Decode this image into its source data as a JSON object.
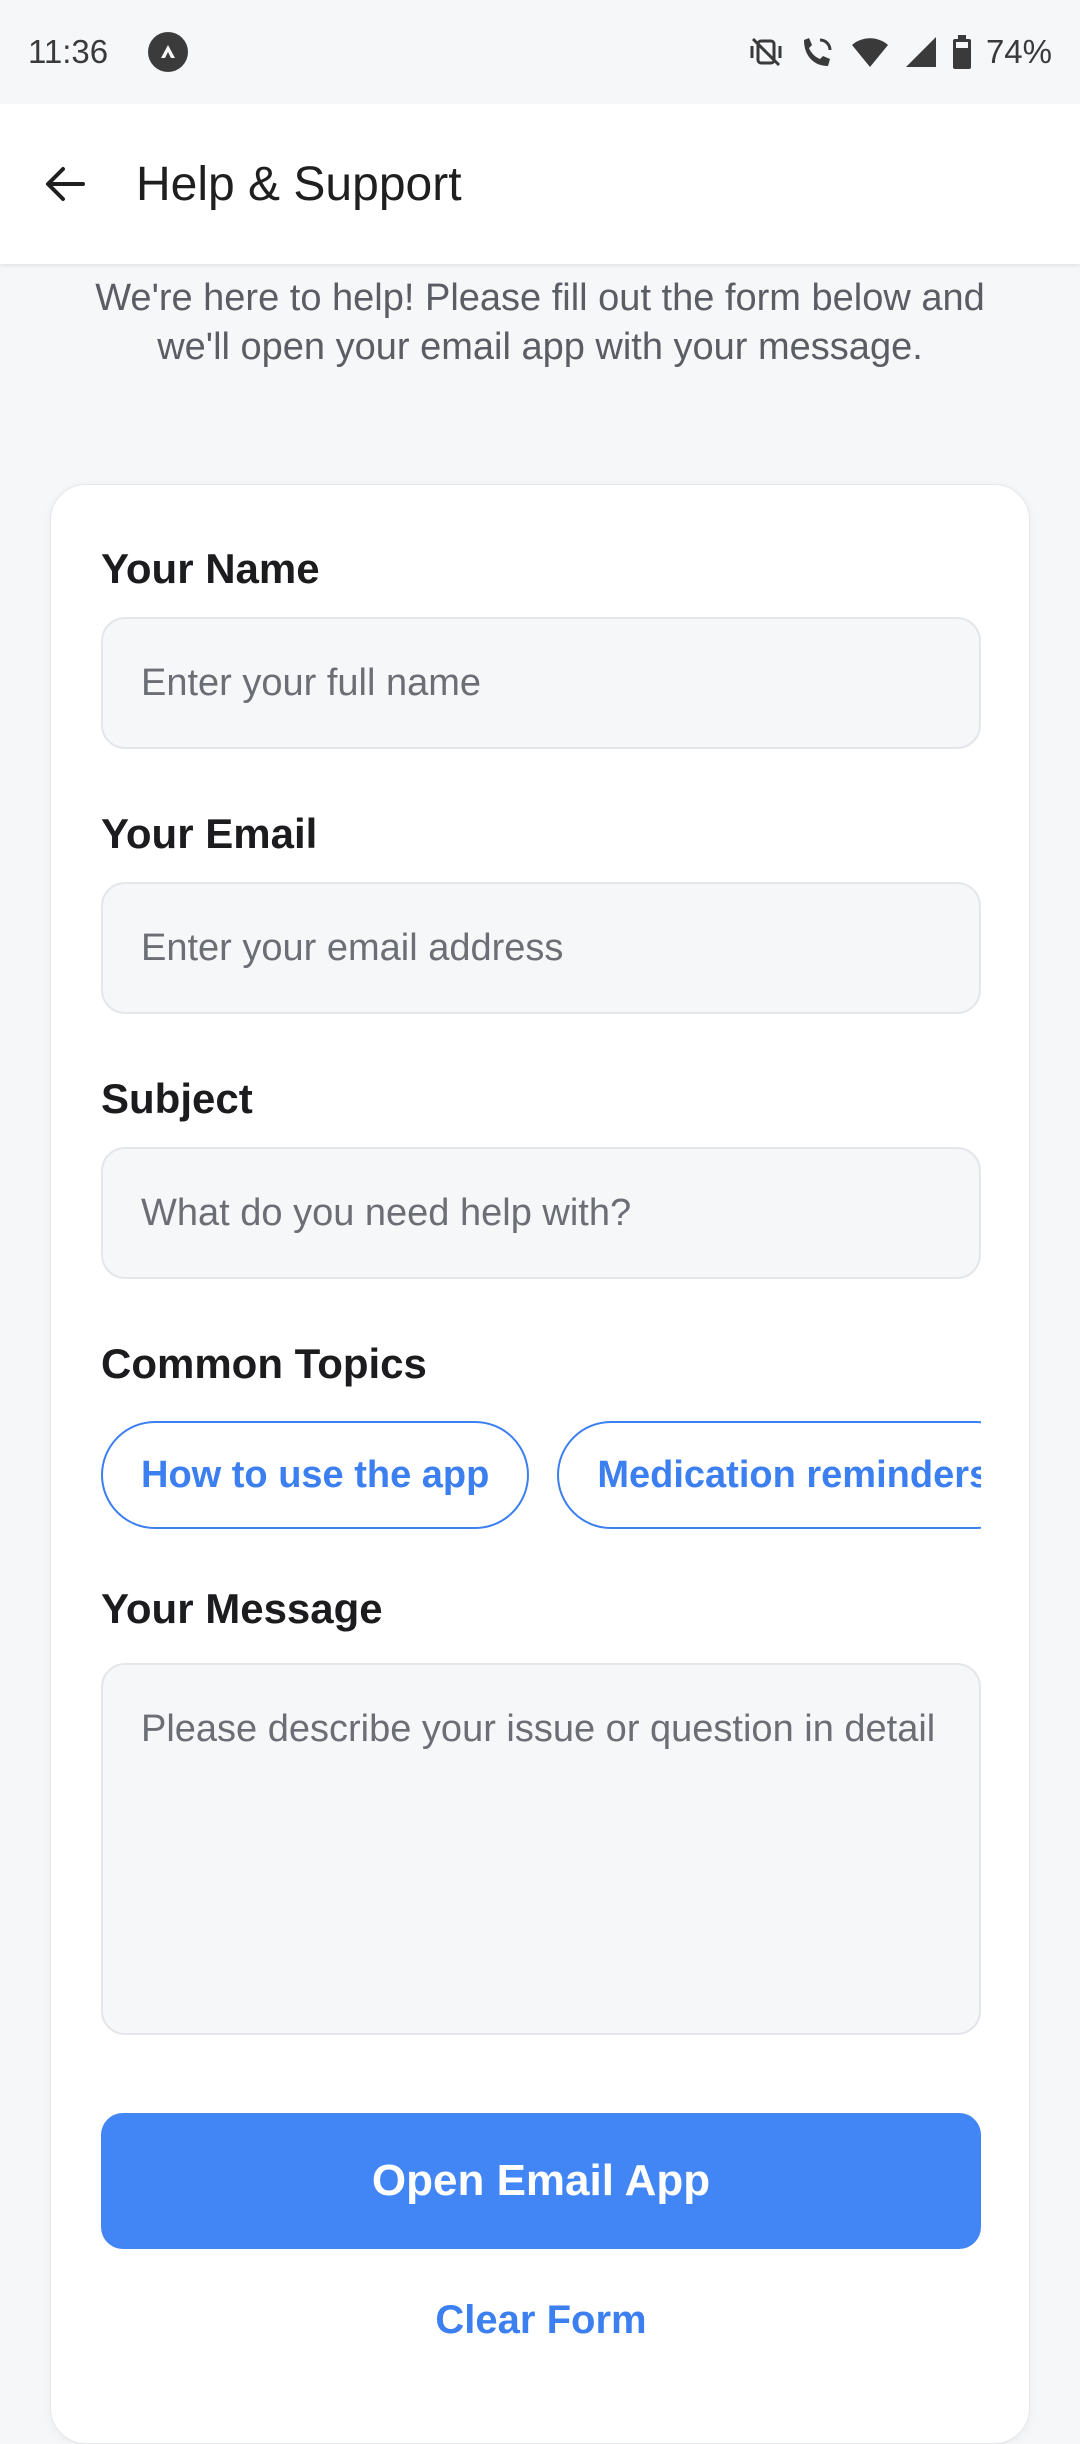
{
  "status_bar": {
    "time": "11:36",
    "battery": "74%"
  },
  "header": {
    "title": "Help & Support"
  },
  "intro_text": "We're here to help! Please fill out the form below and we'll open your email app with your message.",
  "form": {
    "name": {
      "label": "Your Name",
      "placeholder": "Enter your full name"
    },
    "email": {
      "label": "Your Email",
      "placeholder": "Enter your email address"
    },
    "subject": {
      "label": "Subject",
      "placeholder": "What do you need help with?"
    },
    "topics": {
      "label": "Common Topics",
      "chips": [
        "How to use the app",
        "Medication reminders"
      ]
    },
    "message": {
      "label": "Your Message",
      "placeholder": "Please describe your issue or question in detail"
    },
    "submit_label": "Open Email App",
    "clear_label": "Clear Form"
  },
  "colors": {
    "accent": "#4285f4",
    "chip_outline": "#3b7ff0",
    "background": "#f6f7f9"
  }
}
